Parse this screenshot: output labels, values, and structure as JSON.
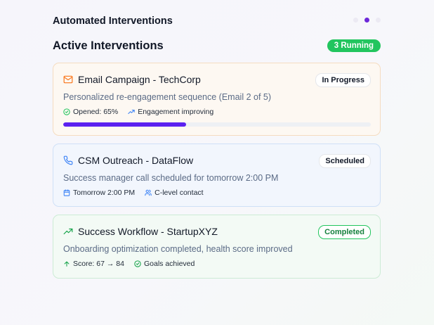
{
  "header": {
    "title": "Automated Interventions"
  },
  "pager": {
    "count": 3,
    "active": 1,
    "accent": "#6d28d9"
  },
  "section": {
    "title": "Active Interventions",
    "badge": "3 Running"
  },
  "cards": [
    {
      "icon": "mail-icon",
      "title": "Email Campaign - TechCorp",
      "status": "In Progress",
      "description": "Personalized re-engagement sequence (Email 2 of 5)",
      "meta": [
        {
          "icon": "check-circle-icon",
          "text": "Opened: 65%"
        },
        {
          "icon": "trending-up-icon",
          "text": "Engagement improving"
        }
      ],
      "progress": 0.4
    },
    {
      "icon": "phone-icon",
      "title": "CSM Outreach - DataFlow",
      "status": "Scheduled",
      "description": "Success manager call scheduled for tomorrow 2:00 PM",
      "meta": [
        {
          "icon": "calendar-icon",
          "text": "Tomorrow 2:00 PM"
        },
        {
          "icon": "users-icon",
          "text": "C-level contact"
        }
      ]
    },
    {
      "icon": "trending-up-icon",
      "title": "Success Workflow - StartupXYZ",
      "status": "Completed",
      "description": "Onboarding optimization completed, health score improved",
      "meta": [
        {
          "icon": "arrow-up-icon",
          "text": "Score: 67 → 84"
        },
        {
          "icon": "check-circle-icon",
          "text": "Goals achieved"
        }
      ]
    }
  ]
}
